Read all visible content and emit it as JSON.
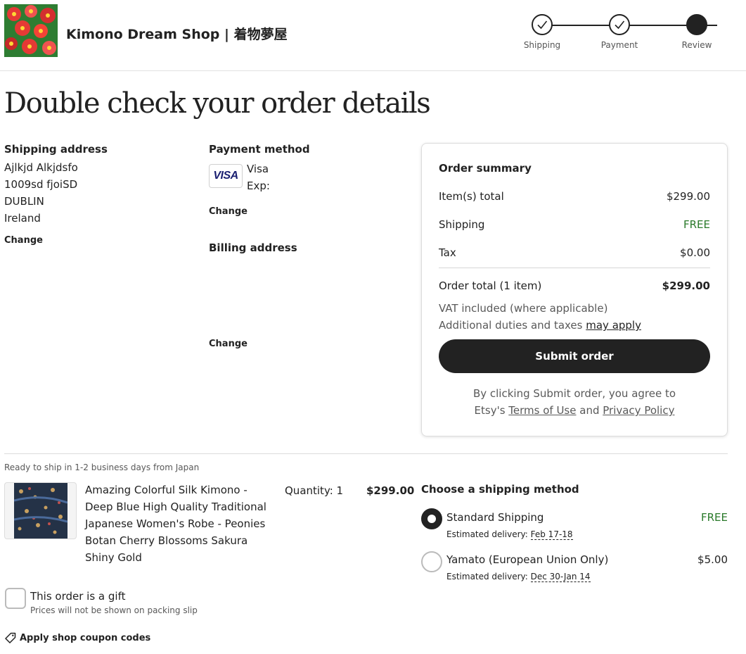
{
  "header": {
    "shop_name": "Kimono Dream Shop | 着物夢屋",
    "steps": [
      {
        "label": "Shipping",
        "state": "complete"
      },
      {
        "label": "Payment",
        "state": "complete"
      },
      {
        "label": "Review",
        "state": "current"
      }
    ]
  },
  "page_title": "Double check your order details",
  "shipping_address": {
    "title": "Shipping address",
    "lines": [
      "Ajlkjd Alkjdsfo",
      "1009sd fjoiSD",
      "DUBLIN",
      "Ireland"
    ],
    "change_label": "Change"
  },
  "payment": {
    "title": "Payment method",
    "card_logo_text": "VISA",
    "card_brand": "Visa",
    "exp_label": "Exp:",
    "change_label": "Change"
  },
  "billing_address": {
    "title": "Billing address",
    "change_label": "Change"
  },
  "order_summary": {
    "title": "Order summary",
    "items_total_label": "Item(s) total",
    "items_total_value": "$299.00",
    "shipping_label": "Shipping",
    "shipping_value": "FREE",
    "tax_label": "Tax",
    "tax_value": "$0.00",
    "order_total_label": "Order total (1 item)",
    "order_total_value": "$299.00",
    "vat_note": "VAT included (where applicable)",
    "duties_prefix": "Additional duties and taxes ",
    "duties_link": "may apply",
    "submit_label": "Submit order",
    "agree_prefix": "By clicking Submit order, you agree to",
    "agree_etsy": "Etsy's ",
    "terms_link": "Terms of Use",
    "agree_and": " and ",
    "privacy_link": "Privacy Policy",
    "free_color": "#2a7a2a"
  },
  "ready_to_ship": "Ready to ship in 1-2 business days from Japan",
  "item": {
    "title": "Amazing Colorful Silk Kimono - Deep Blue High Quality Traditional Japanese Women's Robe - Peonies Botan Cherry Blossoms Sakura Shiny Gold",
    "quantity": "Quantity: 1",
    "price": "$299.00"
  },
  "shipping_methods": {
    "title": "Choose a shipping method",
    "estimated_label": "Estimated delivery:",
    "options": [
      {
        "name": "Standard Shipping",
        "price": "FREE",
        "date": "Feb 17-18",
        "selected": true
      },
      {
        "name": "Yamato (European Union Only)",
        "price": "$5.00",
        "date": "Dec 30-Jan 14",
        "selected": false
      }
    ]
  },
  "gift": {
    "label": "This order is a gift",
    "sub": "Prices will not be shown on packing slip"
  },
  "coupon_label": "Apply shop coupon codes"
}
